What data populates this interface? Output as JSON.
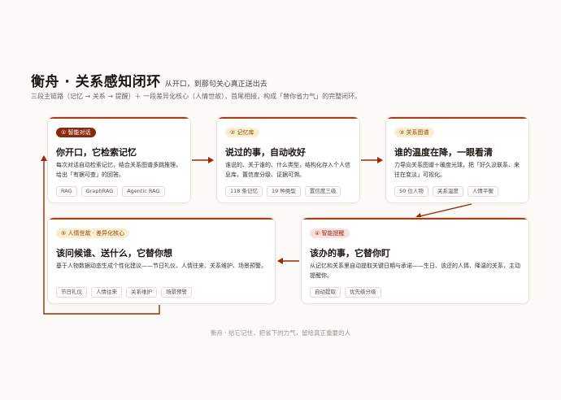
{
  "header": {
    "title": "衡舟 · 关系感知闭环",
    "tagline": "从开口，到那句关心真正送出去",
    "subtitle": "三段主链路（记忆 → 关系 → 提醒）＋ 一段差异化核心（人情世故），首尾相接，构成「替你省力气」的完整闭环。"
  },
  "cards": [
    {
      "badge": "① 智能对话",
      "title": "你开口，它检索记忆",
      "desc": "每次对话自动检索记忆，结合关系图谱多跳推理，给出「有据可查」的回答。",
      "tags": [
        "RAG",
        "GraphRAG",
        "Agentic RAG"
      ]
    },
    {
      "badge": "② 记忆库",
      "title": "说过的事，自动收好",
      "desc": "谁说的、关于谁的、什么类型，结构化存入个人信息库，置信度分级、证据可溯。",
      "tags": [
        "118 条记忆",
        "19 种类型",
        "置信度三级"
      ]
    },
    {
      "badge": "③ 关系图谱",
      "title": "谁的温度在降，一眼看清",
      "desc": "力导向关系图谱＋暖度光球，把「好久没联系、来往在变淡」可视化。",
      "tags": [
        "50 位人物",
        "关系温度",
        "人情平衡"
      ]
    },
    {
      "badge": "④ 智能提醒",
      "title": "该办的事，它替你盯",
      "desc": "从记忆和关系里自动提取关键日期与承诺——生日、该还的人情、降温的关系，主动提醒你。",
      "tags": [
        "自动提取",
        "优先级分级"
      ]
    },
    {
      "badge": "⑤ 人情世故 · 差异化核心",
      "title": "该问候谁、送什么，它替你想",
      "desc": "基于人物数据动态生成个性化建议——节日礼仪、人情往来、关系维护、场景预警。",
      "tags": [
        "节日礼仪",
        "人情往来",
        "关系维护",
        "场景预警"
      ]
    }
  ],
  "footer": "衡舟 · 给它记住，把省下的力气，留给真正重要的人",
  "colors": {
    "accent": "#b23a10",
    "dark_badge": "#8a2a0c",
    "light_badge": "#fbeecf",
    "pink_badge": "#fbe1de"
  }
}
